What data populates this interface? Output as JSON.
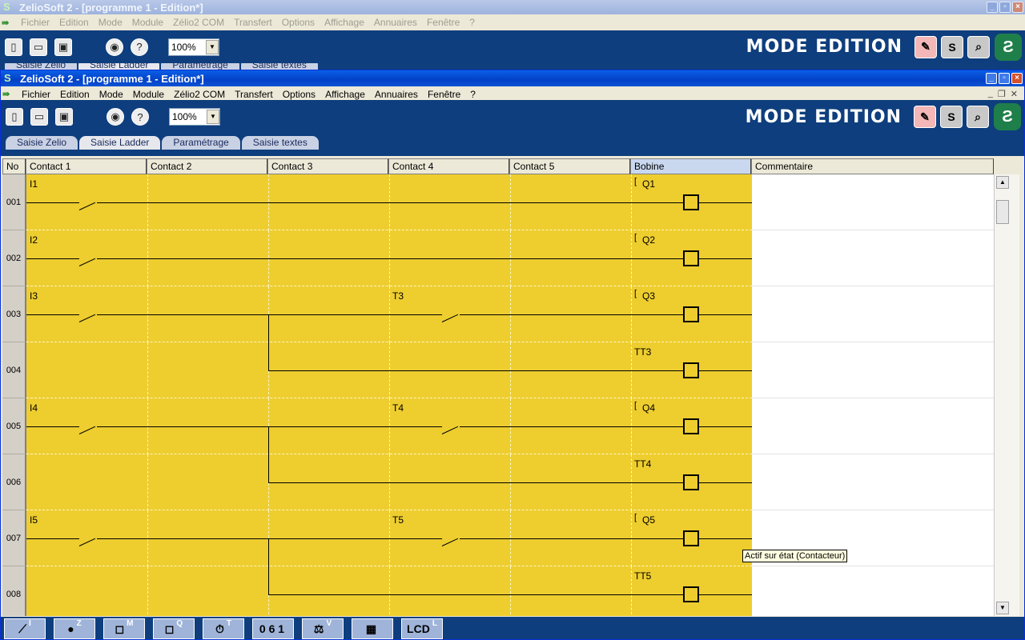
{
  "bg_window": {
    "title": "ZelioSoft 2 - [programme 1 - Edition*]",
    "menu": [
      "Fichier",
      "Edition",
      "Mode",
      "Module",
      "Zélio2 COM",
      "Transfert",
      "Options",
      "Affichage",
      "Annuaires",
      "Fenêtre",
      "?"
    ],
    "zoom": "100%",
    "mode_label": "MODE EDITION",
    "tabs": [
      "Saisie Zelio",
      "Saisie Ladder",
      "Paramétrage",
      "Saisie textes"
    ]
  },
  "window": {
    "title": "ZelioSoft 2 - [programme 1 - Edition*]",
    "menu": [
      "Fichier",
      "Edition",
      "Mode",
      "Module",
      "Zélio2 COM",
      "Transfert",
      "Options",
      "Affichage",
      "Annuaires",
      "Fenêtre",
      "?"
    ],
    "zoom": "100%",
    "mode_label": "MODE EDITION",
    "mode_buttons": [
      "S"
    ],
    "tabs": [
      "Saisie Zelio",
      "Saisie Ladder",
      "Paramétrage",
      "Saisie textes"
    ],
    "active_tab": 1
  },
  "grid": {
    "headers": [
      "No",
      "Contact 1",
      "Contact 2",
      "Contact 3",
      "Contact 4",
      "Contact 5",
      "Bobine",
      "Commentaire"
    ],
    "rows": [
      {
        "no": "001",
        "c1": "I1",
        "c4": "",
        "coil": "Q1",
        "bracket": "["
      },
      {
        "no": "002",
        "c1": "I2",
        "c4": "",
        "coil": "Q2",
        "bracket": "["
      },
      {
        "no": "003",
        "c1": "I3",
        "c4": "T3",
        "coil": "Q3",
        "bracket": "["
      },
      {
        "no": "004",
        "c1": "",
        "c4": "",
        "coil": "TT3",
        "bracket": ""
      },
      {
        "no": "005",
        "c1": "I4",
        "c4": "T4",
        "coil": "Q4",
        "bracket": "["
      },
      {
        "no": "006",
        "c1": "",
        "c4": "",
        "coil": "TT4",
        "bracket": ""
      },
      {
        "no": "007",
        "c1": "I5",
        "c4": "T5",
        "coil": "Q5",
        "bracket": "["
      },
      {
        "no": "008",
        "c1": "",
        "c4": "",
        "coil": "TT5",
        "bracket": ""
      }
    ]
  },
  "tooltip": "Actif sur état (Contacteur)",
  "bottom_tools": [
    {
      "icon": "contact-icon",
      "glyph": "⟋",
      "letter": "I"
    },
    {
      "icon": "z-key-icon",
      "glyph": "●",
      "letter": "Z"
    },
    {
      "icon": "relay-icon",
      "glyph": "◻",
      "letter": "M"
    },
    {
      "icon": "output-icon",
      "glyph": "◻",
      "letter": "Q"
    },
    {
      "icon": "timer-icon",
      "glyph": "⏱",
      "letter": "T"
    },
    {
      "icon": "counter-icon",
      "glyph": "0 6 1",
      "letter": ""
    },
    {
      "icon": "comparator-icon",
      "glyph": "⚖",
      "letter": "V"
    },
    {
      "icon": "grid-icon",
      "glyph": "▦",
      "letter": ""
    },
    {
      "icon": "lcd-icon",
      "glyph": "LCD",
      "letter": "L"
    }
  ]
}
